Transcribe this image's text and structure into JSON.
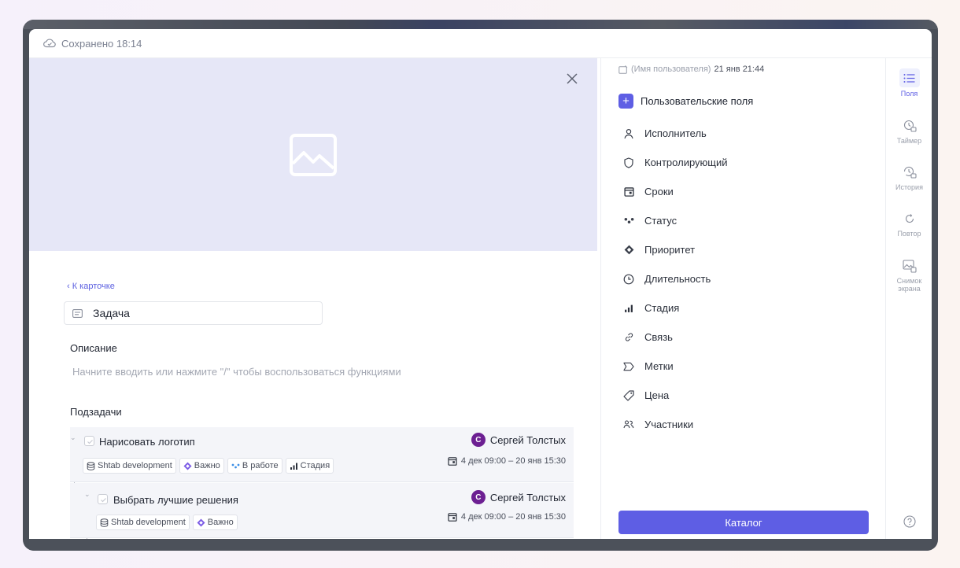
{
  "topbar": {
    "saved_text": "Сохранено 18:14",
    "icon": "cloud-check-icon"
  },
  "cover": {
    "close_icon": "close-icon",
    "placeholder_icon": "image-placeholder-icon"
  },
  "task": {
    "back_link": "‹ К карточке",
    "title": "Задача",
    "description_label": "Описание",
    "description_placeholder": "Начните вводить или нажмите \"/\" чтобы воспользоваться функциями",
    "subtasks_label": "Подзадачи"
  },
  "subtasks": [
    {
      "name": "Нарисовать логотип",
      "assignee_initial": "С",
      "assignee": "Сергей Толстых",
      "tags": [
        {
          "label": "Shtab development",
          "icon": "database-icon"
        },
        {
          "label": "Важно",
          "icon": "priority-icon"
        },
        {
          "label": "В работе",
          "icon": "status-icon"
        },
        {
          "label": "Стадия",
          "icon": "stage-icon"
        }
      ],
      "dates": "4 дек 09:00 – 20 янв 15:30"
    },
    {
      "name": "Выбрать лучшие решения",
      "assignee_initial": "С",
      "assignee": "Сергей Толстых",
      "tags": [
        {
          "label": "Shtab development",
          "icon": "database-icon"
        },
        {
          "label": "Важно",
          "icon": "priority-icon"
        }
      ],
      "dates": "4 дек 09:00 – 20 янв 15:30"
    }
  ],
  "panel": {
    "meta_user": "(Имя пользователя)",
    "meta_date": "21 янв 21:44",
    "custom_fields": "Пользовательские поля",
    "fields": [
      {
        "label": "Исполнитель",
        "icon": "user-icon"
      },
      {
        "label": "Контролирующий",
        "icon": "shield-icon"
      },
      {
        "label": "Сроки",
        "icon": "calendar-icon"
      },
      {
        "label": "Статус",
        "icon": "status-icon"
      },
      {
        "label": "Приоритет",
        "icon": "priority-icon"
      },
      {
        "label": "Длительность",
        "icon": "clock-icon"
      },
      {
        "label": "Стадия",
        "icon": "stage-icon"
      },
      {
        "label": "Связь",
        "icon": "link-icon"
      },
      {
        "label": "Метки",
        "icon": "tag-outline-icon"
      },
      {
        "label": "Цена",
        "icon": "price-tag-icon"
      },
      {
        "label": "Участники",
        "icon": "participants-icon"
      }
    ],
    "catalog_button": "Каталог"
  },
  "rail": [
    {
      "label": "Поля",
      "icon": "list-icon",
      "active": true
    },
    {
      "label": "Таймер",
      "icon": "timer-icon"
    },
    {
      "label": "История",
      "icon": "history-icon"
    },
    {
      "label": "Повтор",
      "icon": "repeat-icon"
    },
    {
      "label": "Снимок экрана",
      "icon": "screenshot-icon"
    }
  ],
  "colors": {
    "accent": "#5e5ee4",
    "avatar": "#6c1f92",
    "cover": "#e6e7f7",
    "subtask_bg": "#f4f5f9"
  }
}
